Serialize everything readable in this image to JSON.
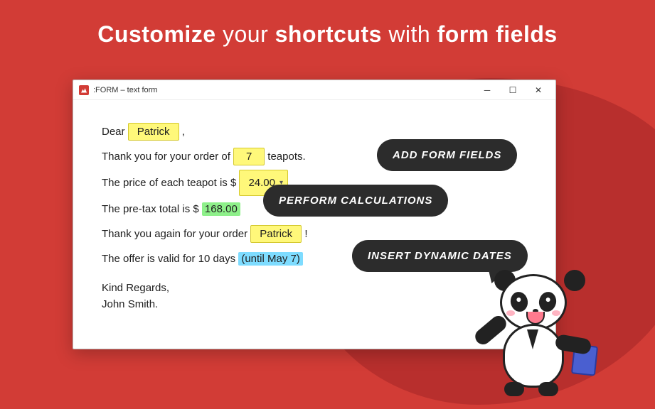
{
  "headline": {
    "p1": "Customize",
    "p2": " your ",
    "p3": "shortcuts",
    "p4": " with ",
    "p5": "form fields"
  },
  "window": {
    "title": ":FORM – text form"
  },
  "letter": {
    "dear": "Dear",
    "comma": ",",
    "name_field": "Patrick",
    "line2_a": "Thank you for your order of",
    "qty_field": "7",
    "line2_b": "teapots.",
    "line3_a": "The price of each teapot is $",
    "price_field": "24.00",
    "line4_a": "The pre-tax total is $",
    "total_calc": "168.00",
    "line5_a": "Thank you again for your order",
    "name_field2": "Patrick",
    "excl": "!",
    "line6_a": "The offer is valid for 10 days",
    "dyn_date": "(until May 7)",
    "sign1": "Kind Regards,",
    "sign2": "John Smith."
  },
  "callouts": {
    "c1": "ADD FORM FIELDS",
    "c2": "PERFORM CALCULATIONS",
    "c3": "INSERT DYNAMIC DATES"
  }
}
